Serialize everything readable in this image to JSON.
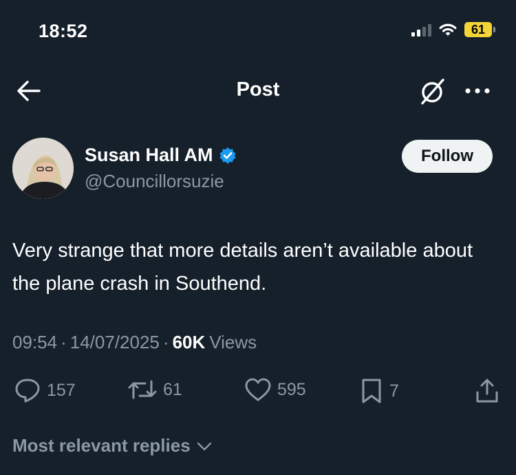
{
  "status_bar": {
    "time": "18:52",
    "battery_level": "61"
  },
  "nav": {
    "title": "Post"
  },
  "author": {
    "display_name": "Susan Hall AM",
    "handle": "@Councillorsuzie",
    "follow_label": "Follow",
    "verified": true
  },
  "tweet": {
    "text": "Very strange that more details aren’t available about the plane crash in Southend.",
    "time": "09:54",
    "date": "14/07/2025",
    "separator": "·",
    "views_count": "60K",
    "views_label": "Views"
  },
  "actions": {
    "replies": "157",
    "reposts": "61",
    "likes": "595",
    "bookmarks": "7"
  },
  "replies_sort": {
    "label": "Most relevant replies"
  },
  "colors": {
    "background": "#15202b",
    "secondary_text": "#8b98a5",
    "verified_blue": "#1d9bf0",
    "battery_yellow": "#f4d538",
    "follow_bg": "#eff3f4"
  }
}
